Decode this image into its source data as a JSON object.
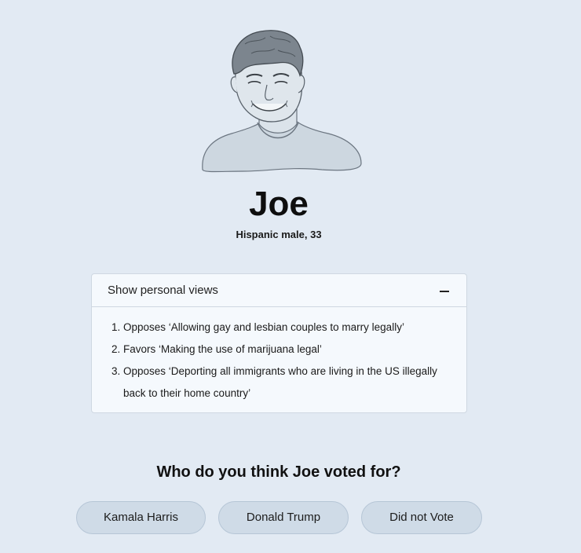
{
  "profile": {
    "name": "Joe",
    "subtitle": "Hispanic male, 33",
    "portrait_icon": "person-portrait-illustration"
  },
  "views": {
    "toggle_label": "Show personal views",
    "toggle_icon": "minus-icon",
    "expanded": true,
    "items": [
      "Opposes ‘Allowing gay and lesbian couples to marry legally’",
      "Favors ‘Making the use of marijuana legal’",
      "Opposes ‘Deporting all immigrants who are living in the US illegally back to their home country’"
    ]
  },
  "question": "Who do you think Joe voted for?",
  "options": [
    "Kamala Harris",
    "Donald Trump",
    "Did not Vote"
  ],
  "colors": {
    "background": "#e2eaf3",
    "card": "#f5f9fd",
    "button": "#cfdbe7",
    "button_border": "#b6c6d6"
  }
}
